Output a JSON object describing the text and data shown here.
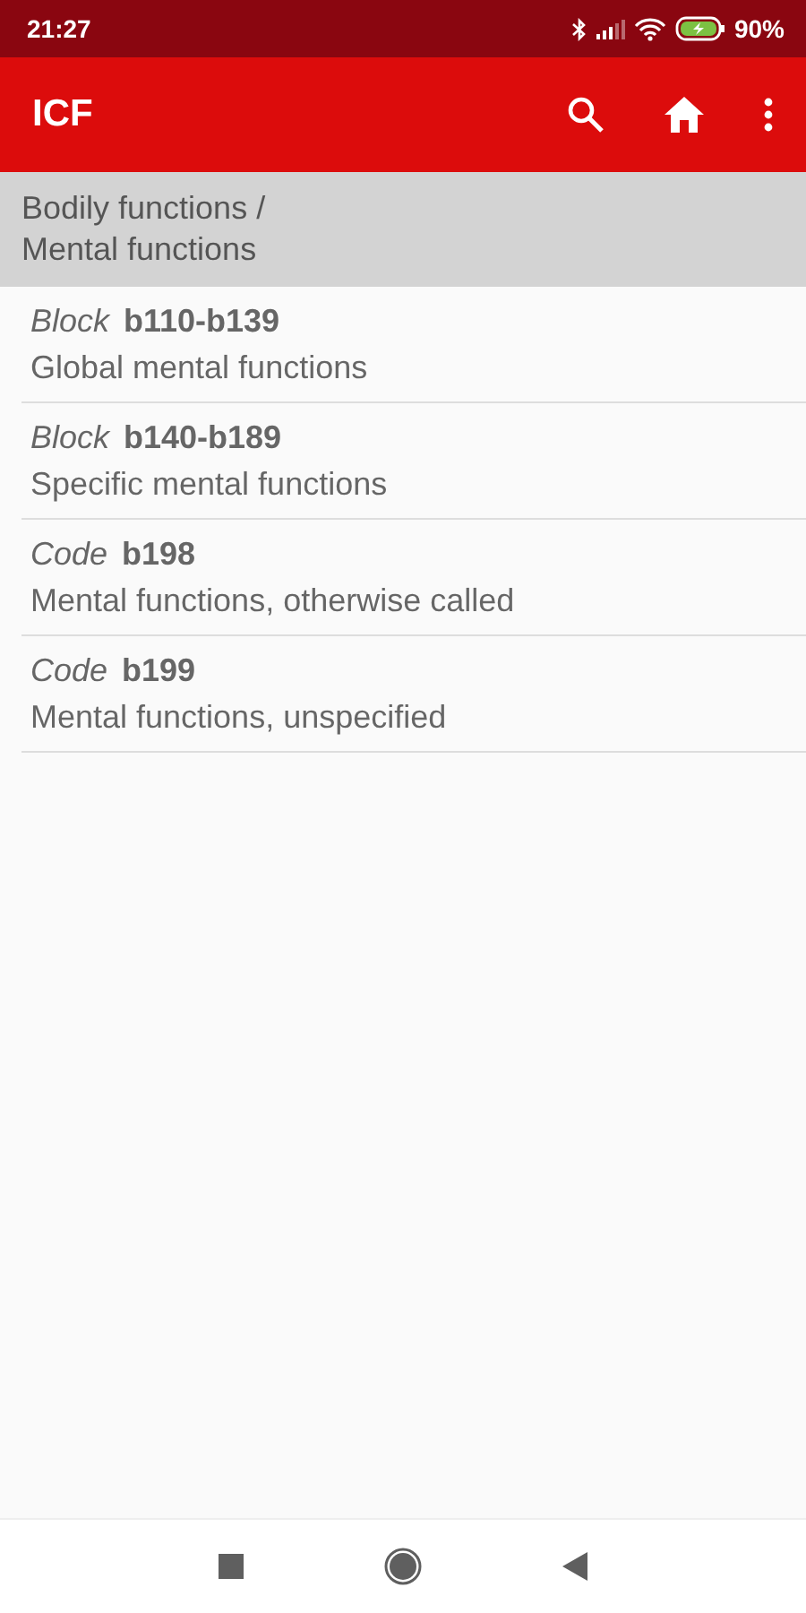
{
  "status_bar": {
    "time": "21:27",
    "battery": "90%"
  },
  "app_bar": {
    "title": "ICF"
  },
  "breadcrumb": [
    "Bodily functions /",
    "Mental functions"
  ],
  "items": [
    {
      "type_label": "Block",
      "code": "b110-b139",
      "title": "Global mental functions"
    },
    {
      "type_label": "Block",
      "code": "b140-b189",
      "title": "Specific mental functions"
    },
    {
      "type_label": "Code",
      "code": "b198",
      "title": "Mental functions, otherwise called"
    },
    {
      "type_label": "Code",
      "code": "b199",
      "title": "Mental functions, unspecified"
    }
  ]
}
